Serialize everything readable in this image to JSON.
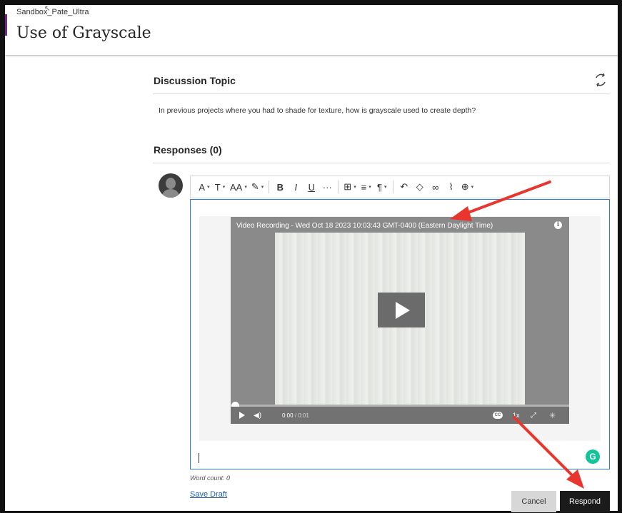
{
  "header": {
    "course_name": "Sandbox_Pate_Ultra",
    "page_title": "Use of Grayscale"
  },
  "topic": {
    "title": "Discussion Topic",
    "text": "In previous projects where you had to shade for texture, how is grayscale used to create depth?"
  },
  "responses": {
    "title": "Responses (0)"
  },
  "toolbar": {
    "items": [
      {
        "icon": "text-style-icon",
        "glyph": "A",
        "dropdown": true
      },
      {
        "icon": "paragraph-format-icon",
        "glyph": "T",
        "dropdown": true
      },
      {
        "icon": "font-size-icon",
        "glyph": "AA",
        "dropdown": true
      },
      {
        "icon": "highlight-icon",
        "glyph": "✎",
        "dropdown": true
      },
      {
        "icon": "bold-icon",
        "glyph": "B"
      },
      {
        "icon": "italic-icon",
        "glyph": "I"
      },
      {
        "icon": "underline-icon",
        "glyph": "U"
      },
      {
        "icon": "more-icon",
        "glyph": "···"
      },
      {
        "icon": "table-icon",
        "glyph": "⊞",
        "dropdown": true
      },
      {
        "icon": "align-icon",
        "glyph": "≡",
        "dropdown": true
      },
      {
        "icon": "paragraph-icon",
        "glyph": "¶",
        "dropdown": true
      },
      {
        "icon": "undo-icon",
        "glyph": "↶"
      },
      {
        "icon": "eraser-icon",
        "glyph": "◇"
      },
      {
        "icon": "link-icon",
        "glyph": "∞"
      },
      {
        "icon": "attach-icon",
        "glyph": "⌇"
      },
      {
        "icon": "insert-icon",
        "glyph": "⊕",
        "dropdown": true
      }
    ]
  },
  "video": {
    "title": "Video Recording - Wed Oct 18 2023 10:03:43 GMT-0400 (Eastern Daylight Time)",
    "current_time": "0:00",
    "duration": "/ 0:01",
    "speed": "1x",
    "progress": 0
  },
  "editor": {
    "word_count": "Word count: 0"
  },
  "actions": {
    "save_draft": "Save Draft",
    "cancel": "Cancel",
    "respond": "Respond"
  },
  "colors": {
    "accent": "#6b2a8a",
    "editor_border": "#2f7dd1",
    "arrow": "#e8362f",
    "respond_button": "#1b1b1b"
  }
}
